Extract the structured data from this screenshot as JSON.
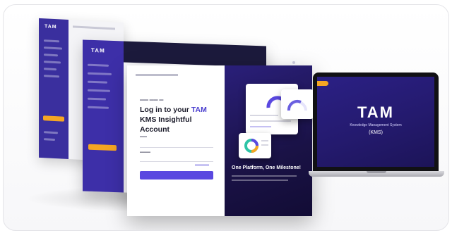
{
  "screen_back": {
    "logo": "TAM"
  },
  "screen_mid": {
    "logo": "TAM"
  },
  "login": {
    "heading_pre": "Log in to your ",
    "heading_accent": "TAM",
    "heading_post": " KMS Insightful Account",
    "tagline": "One Platform, One Milestone!"
  },
  "laptop": {
    "title": "TAM",
    "subtitle": "Knowledge Management System",
    "kms": "(KMS)"
  },
  "colors": {
    "brand_purple": "#3d2fa8",
    "accent_orange": "#f5a623",
    "button_purple": "#5a48e0"
  }
}
